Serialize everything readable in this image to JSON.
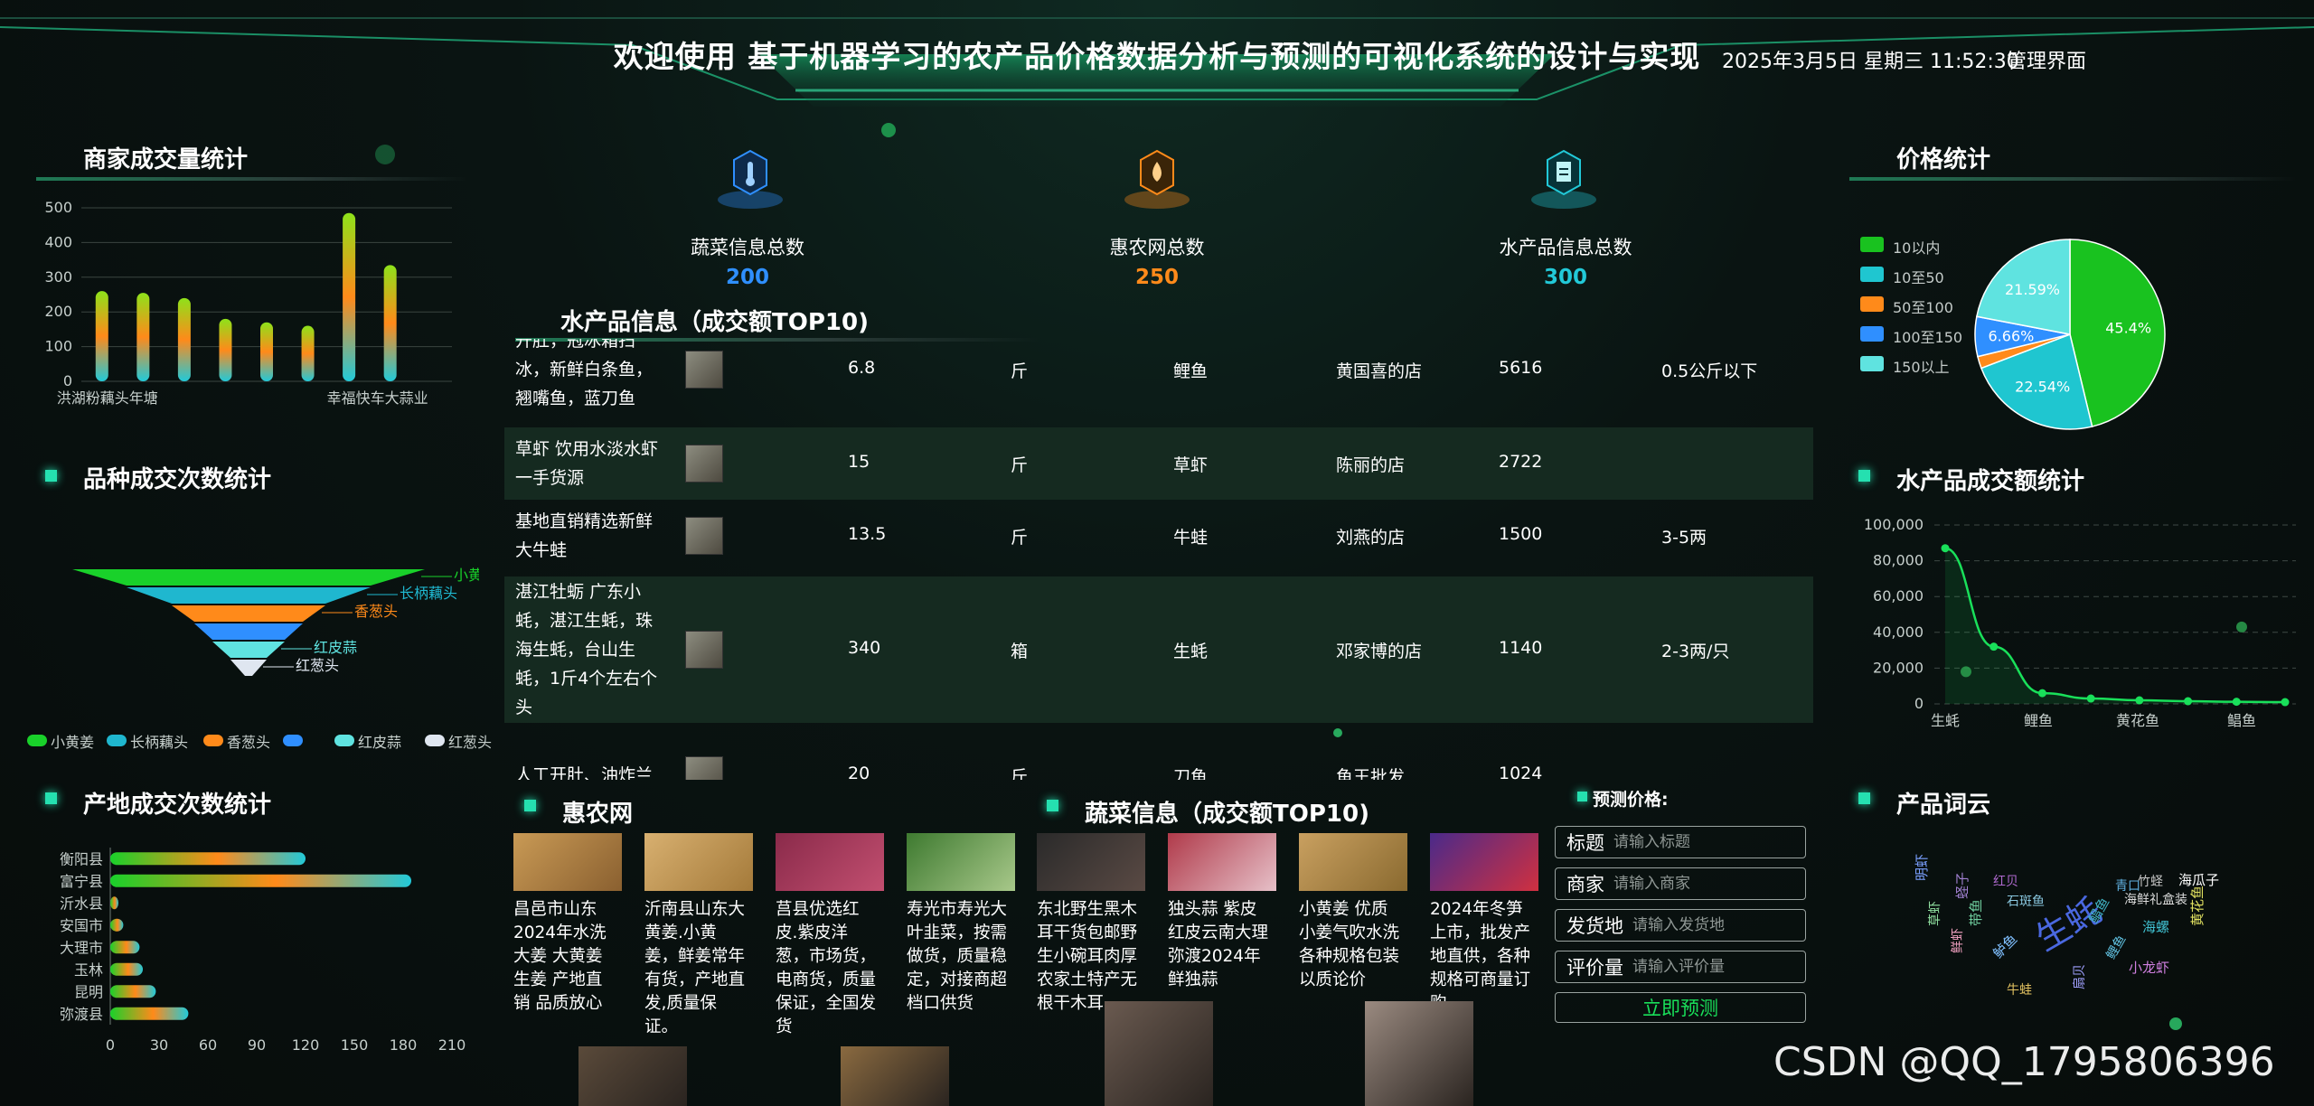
{
  "header": {
    "title": "欢迎使用 基于机器学习的农产品价格数据分析与预测的可视化系统的设计与实现",
    "datetime": "2025年3月5日 星期三 11:52:30",
    "admin_link": "管理界面"
  },
  "colors": {
    "accent": "#25e0b0",
    "green": "#19e05a",
    "blue_num": "#2f8fff",
    "orange_num": "#ff8a1a",
    "cyan_num": "#22c9d8"
  },
  "merchant_chart": {
    "title": "商家成交量统计",
    "chart_data": {
      "type": "bar",
      "categories": [
        "洪湖粉藕头年塘",
        "",
        "",
        "",
        "",
        "",
        "",
        "幸福快车大蒜业",
        ""
      ],
      "x_tick_labels": [
        "洪湖粉藕头年塘",
        "幸福快车大蒜业"
      ],
      "values": [
        260,
        255,
        240,
        180,
        170,
        160,
        485,
        335,
        0
      ],
      "ylim": [
        0,
        500
      ],
      "yticks": [
        0,
        100,
        200,
        300,
        400,
        500
      ],
      "grid": true
    }
  },
  "variety_chart": {
    "title": "品种成交次数统计",
    "chart_data": {
      "type": "funnel",
      "categories": [
        "小黄姜",
        "长柄藕头",
        "香葱头",
        "",
        "红皮蒜",
        "红葱头"
      ],
      "legend": [
        "小黄姜",
        "长柄藕头",
        "香葱头",
        "",
        "红皮蒜",
        "红葱头"
      ],
      "colors": [
        "#19d12a",
        "#1fb7cf",
        "#ff8a1a",
        "#2f8fff",
        "#5fe3e0",
        "#dfe6f0"
      ]
    }
  },
  "region_chart": {
    "title": "产地成交次数统计",
    "chart_data": {
      "type": "bar",
      "orientation": "horizontal",
      "categories": [
        "衡阳县",
        "富宁县",
        "沂水县",
        "安国市",
        "大理市",
        "玉林",
        "昆明",
        "弥渡县"
      ],
      "values": [
        120,
        185,
        5,
        8,
        18,
        20,
        28,
        48
      ],
      "xlim": [
        0,
        210
      ],
      "xticks": [
        0,
        30,
        60,
        90,
        120,
        150,
        180,
        210
      ]
    }
  },
  "stats": [
    {
      "label": "蔬菜信息总数",
      "value": "200",
      "icon": "thermometer-icon"
    },
    {
      "label": "惠农网总数",
      "value": "250",
      "icon": "water-drop-icon"
    },
    {
      "label": "水产品信息总数",
      "value": "300",
      "icon": "clipboard-icon"
    }
  ],
  "aquatic_table": {
    "title": "水产品信息（成交额TOP10)",
    "rows": [
      {
        "name": "开肚，冠冰箱扫冰，新鲜白条鱼，翘嘴鱼，蓝刀鱼",
        "name_lines": [
          "开肚，冠冰箱扫",
          "冰，新鲜白条鱼，",
          "翘嘴鱼，蓝刀鱼"
        ],
        "price": "6.8",
        "unit": "斤",
        "kind": "鲤鱼",
        "shop": "黄国喜的店",
        "amount": "5616",
        "spec": "0.5公斤以下"
      },
      {
        "name": "草虾 饮用水淡水虾一手货源",
        "name_lines": [
          "草虾 饮用水淡水虾",
          "一手货源"
        ],
        "price": "15",
        "unit": "斤",
        "kind": "草虾",
        "shop": "陈丽的店",
        "amount": "2722",
        "spec": ""
      },
      {
        "name": "基地直销精选新鲜大牛蛙",
        "name_lines": [
          "基地直销精选新鲜",
          "大牛蛙"
        ],
        "price": "13.5",
        "unit": "斤",
        "kind": "牛蛙",
        "shop": "刘燕的店",
        "amount": "1500",
        "spec": "3-5两"
      },
      {
        "name": "湛江牡蛎 广东小蚝，湛江生蚝，珠海生蚝，台山生蚝，1斤4个左右个头",
        "name_lines": [
          "湛江牡蛎 广东小",
          "蚝，湛江生蚝，珠",
          "海生蚝，台山生",
          "蚝，1斤4个左右个",
          "头"
        ],
        "price": "340",
        "unit": "箱",
        "kind": "生蚝",
        "shop": "邓家博的店",
        "amount": "1140",
        "spec": "2-3两/只"
      },
      {
        "name": "人工开肚、油炸兰",
        "name_lines": [
          "人工开肚、油炸兰"
        ],
        "price": "20",
        "unit": "斤",
        "kind": "刀鱼",
        "shop": "鱼王批发",
        "amount": "1024",
        "spec": ""
      }
    ]
  },
  "price_chart": {
    "title": "价格统计",
    "chart_data": {
      "type": "pie",
      "categories": [
        "10以内",
        "10至50",
        "50至100",
        "100至150",
        "150以上"
      ],
      "values": [
        45.4,
        22.54,
        2.0,
        6.66,
        21.59
      ],
      "data_labels": [
        "45.4%",
        "22.54%",
        "",
        "6.66%",
        "21.59%"
      ],
      "colors": [
        "#19c21f",
        "#1fc6d0",
        "#ff8a1a",
        "#2f8fff",
        "#5fe3e0"
      ],
      "legend_position": "left"
    }
  },
  "aquatic_amount_chart": {
    "title": "水产品成交额统计",
    "chart_data": {
      "type": "line",
      "x_tick_labels": [
        "生蚝",
        "鲤鱼",
        "黄花鱼",
        "鲳鱼"
      ],
      "values": [
        87000,
        32000,
        6000,
        3000,
        2000,
        1500,
        1200,
        1000
      ],
      "scatter_values": [
        18000,
        43000
      ],
      "ylim": [
        0,
        100000
      ],
      "yticks": [
        "0",
        "20,000",
        "40,000",
        "60,000",
        "80,000",
        "100,000"
      ],
      "grid": true
    }
  },
  "huinong": {
    "title": "惠农网",
    "cards": [
      {
        "lines": [
          "昌邑市山东",
          "2024年水洗",
          "大姜 大黄姜",
          "生姜 产地直",
          "销 品质放心"
        ]
      },
      {
        "lines": [
          "沂南县山东大",
          "黄姜.小黄",
          "姜，鲜姜常年",
          "有货，产地直",
          "发,质量保",
          "证。"
        ]
      },
      {
        "lines": [
          "莒县优选红",
          "皮.紫皮洋",
          "葱，市场货，",
          "电商货，质量",
          "保证，全国发",
          "货"
        ]
      },
      {
        "lines": [
          "寿光市寿光大",
          "叶韭菜，按需",
          "做货，质量稳",
          "定，对接商超",
          "档口供货"
        ]
      }
    ]
  },
  "vegetable": {
    "title": "蔬菜信息（成交额TOP10)",
    "cards": [
      {
        "lines": [
          "东北野生黑木",
          "耳干货包邮野",
          "生小碗耳肉厚",
          "农家土特产无",
          "根干木耳"
        ]
      },
      {
        "lines": [
          "独头蒜 紫皮",
          "红皮云南大理",
          "弥渡2024年",
          "鲜独蒜"
        ]
      },
      {
        "lines": [
          "小黄姜 优质",
          "小姜气吹水洗",
          "各种规格包装",
          "以质论价"
        ]
      },
      {
        "lines": [
          "2024年冬笋",
          "上市，批发产",
          "地直供，各种",
          "规格可商量订",
          "购。"
        ]
      }
    ]
  },
  "predict": {
    "title": "预测价格:",
    "fields": [
      {
        "label": "标题",
        "placeholder": "请输入标题"
      },
      {
        "label": "商家",
        "placeholder": "请输入商家"
      },
      {
        "label": "发货地",
        "placeholder": "请输入发货地"
      },
      {
        "label": "评价量",
        "placeholder": "请输入评价量"
      }
    ],
    "button": "立即预测"
  },
  "wordcloud": {
    "title": "产品词云",
    "words": [
      "生蚝",
      "明虾",
      "海鲜礼盒装",
      "竹蛏",
      "海瓜子",
      "红贝",
      "石斑鱼",
      "鲳鱼",
      "带鱼",
      "青口",
      "海螺",
      "蛏子",
      "牛蛙",
      "小龙虾",
      "鲈鱼",
      "草虾",
      "鲤鱼",
      "扇贝",
      "鲜虾",
      "黄花鱼"
    ]
  },
  "watermark": "CSDN @QQ_1795806396"
}
